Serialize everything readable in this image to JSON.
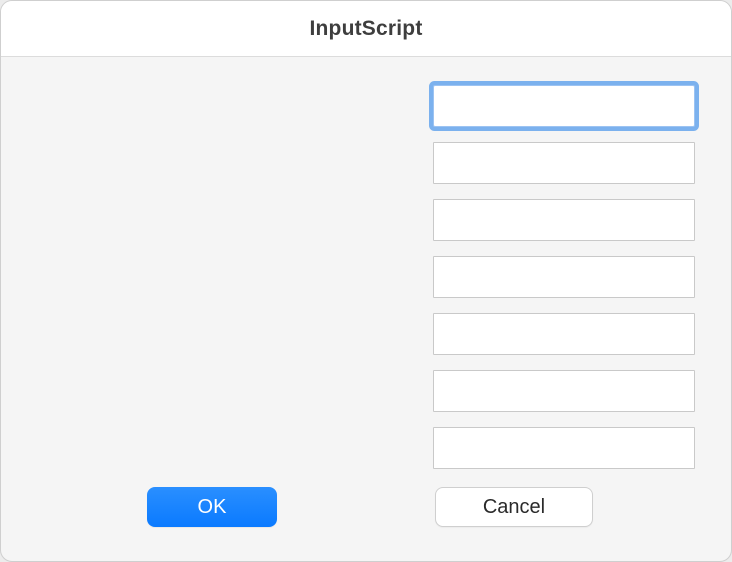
{
  "title": "InputScript",
  "fields": [
    {
      "value": "",
      "focused": true
    },
    {
      "value": "",
      "focused": false
    },
    {
      "value": "",
      "focused": false
    },
    {
      "value": "",
      "focused": false
    },
    {
      "value": "",
      "focused": false
    },
    {
      "value": "",
      "focused": false
    },
    {
      "value": "",
      "focused": false
    }
  ],
  "buttons": {
    "ok": "OK",
    "cancel": "Cancel"
  }
}
